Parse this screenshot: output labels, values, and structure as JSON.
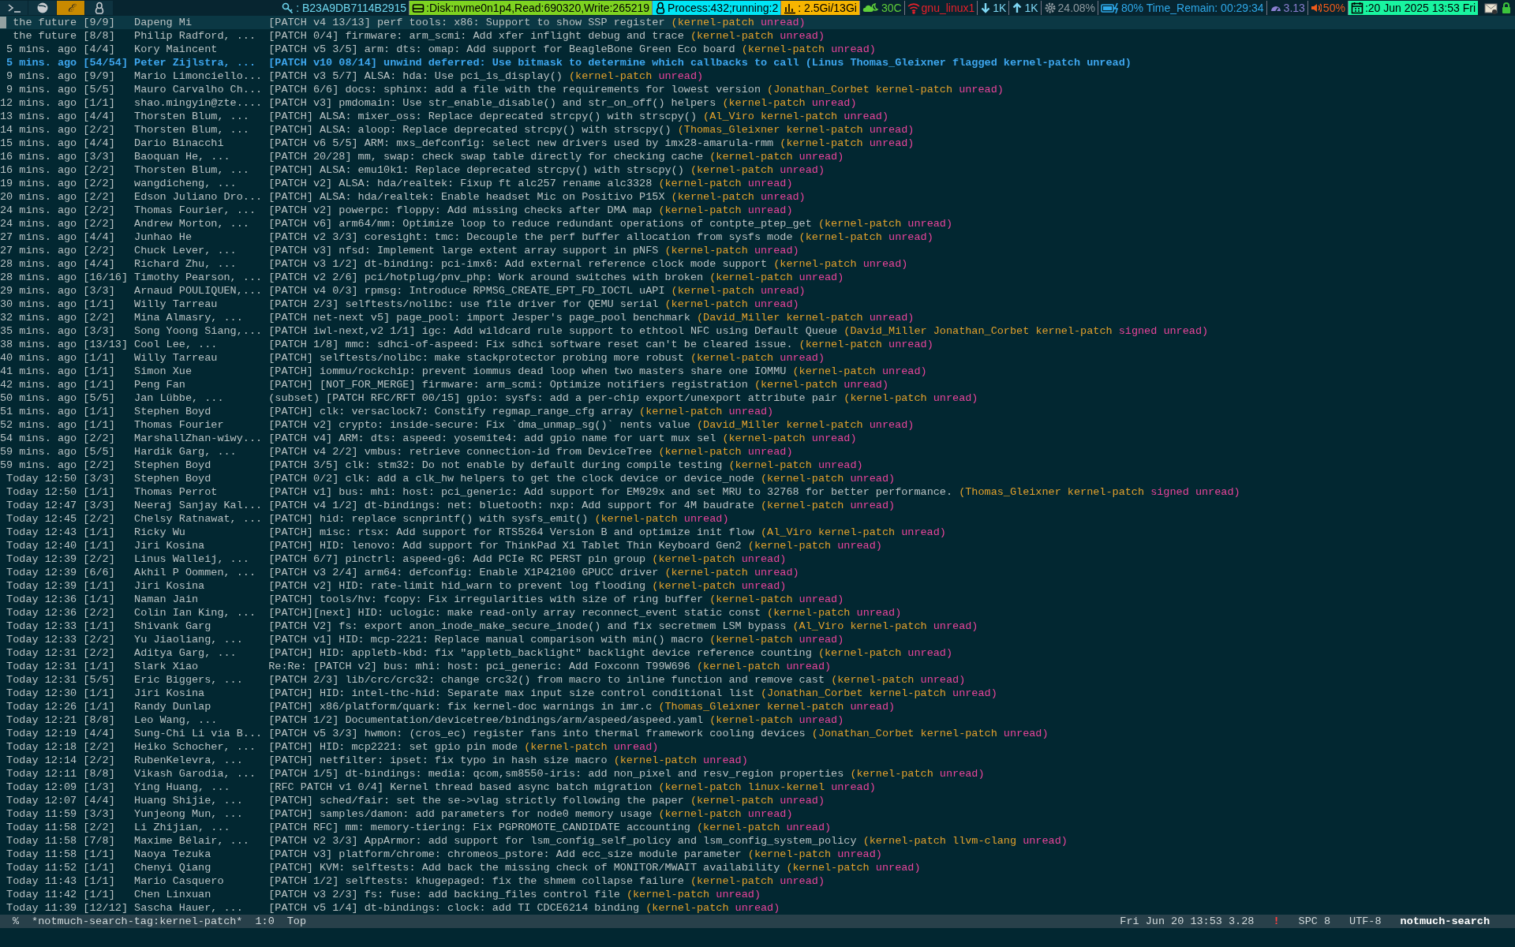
{
  "workspaces": [
    {
      "kind": "terminal",
      "selected": false
    },
    {
      "kind": "browser",
      "selected": false
    },
    {
      "kind": "text",
      "label": "ℰ",
      "selected": true
    },
    {
      "kind": "linux",
      "selected": false
    }
  ],
  "status_segments": [
    {
      "kind": "key",
      "text": ": B23A9DB7114B2915",
      "color": "#6fd8f0",
      "boxed": false
    },
    {
      "kind": "disk",
      "text": ":Disk:nvme0n1p4,Read:690320,Write:265219",
      "color": "#7ed321",
      "boxed": true
    },
    {
      "kind": "linux",
      "text": " Process:432;running:2",
      "color": "#00e5f5",
      "boxed": true
    },
    {
      "kind": "bars",
      "text": " : 2.5Gi/13Gi",
      "color": "#f7b500",
      "boxed": true
    },
    {
      "kind": "weather",
      "text": "30C",
      "color": "#5fcf3a",
      "boxed": false
    },
    {
      "kind": "wifi",
      "text": "gnu_linux1",
      "color": "#e8202a",
      "boxed": false
    },
    {
      "kind": "down",
      "text": "1K",
      "color": "#7fd8f5",
      "boxed": false
    },
    {
      "kind": "up",
      "text": "1K",
      "color": "#7fd8f5",
      "boxed": false
    },
    {
      "kind": "gear",
      "text": "24.08%",
      "color": "#8f9aa0",
      "boxed": false
    },
    {
      "kind": "battery",
      "text": "80% Time_Remain: 00:29:34",
      "color": "#2ea8e8",
      "boxed": false
    },
    {
      "kind": "gauge",
      "text": "3.13",
      "color": "#8a7fd0",
      "boxed": false
    },
    {
      "kind": "speaker",
      "text": "50%",
      "color": "#f05a1a",
      "boxed": false
    },
    {
      "kind": "calendar",
      "text": ":20 Jun 2025 13:53 Fri",
      "color": "#19f5a0",
      "boxed": true
    }
  ],
  "tray": [
    {
      "kind": "mail"
    },
    {
      "kind": "lock"
    }
  ],
  "rows": [
    {
      "date": "the future",
      "count": "[9/9]",
      "authors": "Dapeng Mi",
      "subject": "[PATCH v4 13/13] perf tools: x86: Support to show SSP register",
      "tags": [
        {
          "text": "(kernel-patch",
          "color": "#e2a12c"
        },
        {
          "text": "unread)",
          "color": "#e8449a"
        }
      ],
      "selected": true,
      "flagged": false
    },
    {
      "date": "the future",
      "count": "[8/8]",
      "authors": "Philip Radford, ...",
      "subject": "[PATCH 0/4] firmware: arm_scmi: Add xfer inflight debug and trace",
      "tags": [
        {
          "text": "(kernel-patch",
          "color": "#e2a12c"
        },
        {
          "text": "unread)",
          "color": "#e8449a"
        }
      ],
      "selected": false,
      "flagged": false
    },
    {
      "date": "5 mins. ago",
      "count": "[4/4]",
      "authors": "Kory Maincent",
      "subject": "[PATCH v5 3/5] arm: dts: omap: Add support for BeagleBone Green Eco board",
      "tags": [
        {
          "text": "(kernel-patch",
          "color": "#e2a12c"
        },
        {
          "text": "unread)",
          "color": "#e8449a"
        }
      ],
      "selected": false,
      "flagged": false
    },
    {
      "date": "5 mins. ago",
      "count": "[54/54]",
      "authors": "Peter Zijlstra, ...",
      "subject": "[PATCH v10 08/14] unwind deferred: Use bitmask to determine which callbacks to call",
      "tags": [
        {
          "text": "(Linus",
          "color": "#3ea6ee"
        },
        {
          "text": "Thomas_Gleixner",
          "color": "#3ea6ee"
        },
        {
          "text": "flagged",
          "color": "#3ea6ee"
        },
        {
          "text": "kernel-patch",
          "color": "#3ea6ee"
        },
        {
          "text": "unread)",
          "color": "#3ea6ee"
        }
      ],
      "selected": false,
      "flagged": true
    },
    {
      "date": "9 mins. ago",
      "count": "[9/9]",
      "authors": "Mario Limonciello...",
      "subject": "[PATCH v3 5/7] ALSA: hda: Use pci_is_display()",
      "tags": [
        {
          "text": "(kernel-patch",
          "color": "#e2a12c"
        },
        {
          "text": "unread)",
          "color": "#e8449a"
        }
      ],
      "selected": false,
      "flagged": false
    },
    {
      "date": "9 mins. ago",
      "count": "[5/5]",
      "authors": "Mauro Carvalho Ch...",
      "subject": "[PATCH 6/6] docs: sphinx: add a file with the requirements for lowest version",
      "tags": [
        {
          "text": "(Jonathan_Corbet",
          "color": "#e2a12c"
        },
        {
          "text": "kernel-patch",
          "color": "#e2a12c"
        },
        {
          "text": "unread)",
          "color": "#e8449a"
        }
      ],
      "selected": false,
      "flagged": false
    },
    {
      "date": "12 mins. ago",
      "count": "[1/1]",
      "authors": "shao.mingyin@zte....",
      "subject": "[PATCH v3] pmdomain: Use str_enable_disable() and str_on_off() helpers",
      "tags": [
        {
          "text": "(kernel-patch",
          "color": "#e2a12c"
        },
        {
          "text": "unread)",
          "color": "#e8449a"
        }
      ],
      "selected": false,
      "flagged": false
    },
    {
      "date": "13 mins. ago",
      "count": "[4/4]",
      "authors": "Thorsten Blum, ...",
      "subject": "[PATCH] ALSA: mixer_oss: Replace deprecated strcpy() with strscpy()",
      "tags": [
        {
          "text": "(Al_Viro",
          "color": "#e2a12c"
        },
        {
          "text": "kernel-patch",
          "color": "#e2a12c"
        },
        {
          "text": "unread)",
          "color": "#e8449a"
        }
      ],
      "selected": false,
      "flagged": false
    },
    {
      "date": "14 mins. ago",
      "count": "[2/2]",
      "authors": "Thorsten Blum, ...",
      "subject": "[PATCH] ALSA: aloop: Replace deprecated strcpy() with strscpy()",
      "tags": [
        {
          "text": "(Thomas_Gleixner",
          "color": "#e2a12c"
        },
        {
          "text": "kernel-patch",
          "color": "#e2a12c"
        },
        {
          "text": "unread)",
          "color": "#e8449a"
        }
      ],
      "selected": false,
      "flagged": false
    },
    {
      "date": "15 mins. ago",
      "count": "[4/4]",
      "authors": "Dario Binacchi",
      "subject": "[PATCH v6 5/5] ARM: mxs_defconfig: select new drivers used by imx28-amarula-rmm",
      "tags": [
        {
          "text": "(kernel-patch",
          "color": "#e2a12c"
        },
        {
          "text": "unread)",
          "color": "#e8449a"
        }
      ],
      "selected": false,
      "flagged": false
    },
    {
      "date": "16 mins. ago",
      "count": "[3/3]",
      "authors": "Baoquan He, ...",
      "subject": "[PATCH 20/28] mm, swap: check swap table directly for checking cache",
      "tags": [
        {
          "text": "(kernel-patch",
          "color": "#e2a12c"
        },
        {
          "text": "unread)",
          "color": "#e8449a"
        }
      ],
      "selected": false,
      "flagged": false
    },
    {
      "date": "16 mins. ago",
      "count": "[2/2]",
      "authors": "Thorsten Blum, ...",
      "subject": "[PATCH] ALSA: emu10k1: Replace deprecated strcpy() with strscpy()",
      "tags": [
        {
          "text": "(kernel-patch",
          "color": "#e2a12c"
        },
        {
          "text": "unread)",
          "color": "#e8449a"
        }
      ],
      "selected": false,
      "flagged": false
    },
    {
      "date": "19 mins. ago",
      "count": "[2/2]",
      "authors": "wangdicheng, ...",
      "subject": "[PATCH v2] ALSA: hda/realtek: Fixup ft alc257 rename alc3328",
      "tags": [
        {
          "text": "(kernel-patch",
          "color": "#e2a12c"
        },
        {
          "text": "unread)",
          "color": "#e8449a"
        }
      ],
      "selected": false,
      "flagged": false
    },
    {
      "date": "20 mins. ago",
      "count": "[2/2]",
      "authors": "Edson Juliano Dro...",
      "subject": "[PATCH] ALSA: hda/realtek: Enable headset Mic on Positivo P15X",
      "tags": [
        {
          "text": "(kernel-patch",
          "color": "#e2a12c"
        },
        {
          "text": "unread)",
          "color": "#e8449a"
        }
      ],
      "selected": false,
      "flagged": false
    },
    {
      "date": "24 mins. ago",
      "count": "[2/2]",
      "authors": "Thomas Fourier, ...",
      "subject": "[PATCH v2] powerpc: floppy: Add missing checks after DMA map",
      "tags": [
        {
          "text": "(kernel-patch",
          "color": "#e2a12c"
        },
        {
          "text": "unread)",
          "color": "#e8449a"
        }
      ],
      "selected": false,
      "flagged": false
    },
    {
      "date": "24 mins. ago",
      "count": "[2/2]",
      "authors": "Andrew Morton, ...",
      "subject": "[PATCH v6] arm64/mm: Optimize loop to reduce redundant operations of contpte_ptep_get",
      "tags": [
        {
          "text": "(kernel-patch",
          "color": "#e2a12c"
        },
        {
          "text": "unread)",
          "color": "#e8449a"
        }
      ],
      "selected": false,
      "flagged": false
    },
    {
      "date": "27 mins. ago",
      "count": "[4/4]",
      "authors": "Junhao He",
      "subject": "[PATCH v2 3/3] coresight: tmc: Decouple the perf buffer allocation from sysfs mode",
      "tags": [
        {
          "text": "(kernel-patch",
          "color": "#e2a12c"
        },
        {
          "text": "unread)",
          "color": "#e8449a"
        }
      ],
      "selected": false,
      "flagged": false
    },
    {
      "date": "27 mins. ago",
      "count": "[2/2]",
      "authors": "Chuck Lever, ...",
      "subject": "[PATCH v3] nfsd: Implement large extent array support in pNFS",
      "tags": [
        {
          "text": "(kernel-patch",
          "color": "#e2a12c"
        },
        {
          "text": "unread)",
          "color": "#e8449a"
        }
      ],
      "selected": false,
      "flagged": false
    },
    {
      "date": "28 mins. ago",
      "count": "[4/4]",
      "authors": "Richard Zhu, ...",
      "subject": "[PATCH v3 1/2] dt-binding: pci-imx6: Add external reference clock mode support",
      "tags": [
        {
          "text": "(kernel-patch",
          "color": "#e2a12c"
        },
        {
          "text": "unread)",
          "color": "#e8449a"
        }
      ],
      "selected": false,
      "flagged": false
    },
    {
      "date": "28 mins. ago",
      "count": "[16/16]",
      "authors": "Timothy Pearson, ...",
      "subject": "[PATCH v2 2/6] pci/hotplug/pnv_php: Work around switches with broken",
      "tags": [
        {
          "text": "(kernel-patch",
          "color": "#e2a12c"
        },
        {
          "text": "unread)",
          "color": "#e8449a"
        }
      ],
      "selected": false,
      "flagged": false
    },
    {
      "date": "29 mins. ago",
      "count": "[3/3]",
      "authors": "Arnaud POULIQUEN,...",
      "subject": "[PATCH v4 0/3] rpmsg: Introduce RPMSG_CREATE_EPT_FD_IOCTL uAPI",
      "tags": [
        {
          "text": "(kernel-patch",
          "color": "#e2a12c"
        },
        {
          "text": "unread)",
          "color": "#e8449a"
        }
      ],
      "selected": false,
      "flagged": false
    },
    {
      "date": "30 mins. ago",
      "count": "[1/1]",
      "authors": "Willy Tarreau",
      "subject": "[PATCH 2/3] selftests/nolibc: use file driver for QEMU serial",
      "tags": [
        {
          "text": "(kernel-patch",
          "color": "#e2a12c"
        },
        {
          "text": "unread)",
          "color": "#e8449a"
        }
      ],
      "selected": false,
      "flagged": false
    },
    {
      "date": "32 mins. ago",
      "count": "[2/2]",
      "authors": "Mina Almasry, ...",
      "subject": "[PATCH net-next v5] page_pool: import Jesper's page_pool benchmark",
      "tags": [
        {
          "text": "(David_Miller",
          "color": "#e2a12c"
        },
        {
          "text": "kernel-patch",
          "color": "#e2a12c"
        },
        {
          "text": "unread)",
          "color": "#e8449a"
        }
      ],
      "selected": false,
      "flagged": false
    },
    {
      "date": "35 mins. ago",
      "count": "[3/3]",
      "authors": "Song Yoong Siang,...",
      "subject": "[PATCH iwl-next,v2 1/1] igc: Add wildcard rule support to ethtool NFC using Default Queue",
      "tags": [
        {
          "text": "(David_Miller",
          "color": "#e2a12c"
        },
        {
          "text": "Jonathan_Corbet",
          "color": "#e2a12c"
        },
        {
          "text": "kernel-patch",
          "color": "#e2a12c"
        },
        {
          "text": "signed",
          "color": "#e8449a"
        },
        {
          "text": "unread)",
          "color": "#e8449a"
        }
      ],
      "selected": false,
      "flagged": false
    },
    {
      "date": "38 mins. ago",
      "count": "[13/13]",
      "authors": "Cool Lee, ...",
      "subject": "[PATCH 1/8] mmc: sdhci-of-aspeed: Fix sdhci software reset can't be cleared issue.",
      "tags": [
        {
          "text": "(kernel-patch",
          "color": "#e2a12c"
        },
        {
          "text": "unread)",
          "color": "#e8449a"
        }
      ],
      "selected": false,
      "flagged": false
    },
    {
      "date": "40 mins. ago",
      "count": "[1/1]",
      "authors": "Willy Tarreau",
      "subject": "[PATCH] selftests/nolibc: make stackprotector probing more robust",
      "tags": [
        {
          "text": "(kernel-patch",
          "color": "#e2a12c"
        },
        {
          "text": "unread)",
          "color": "#e8449a"
        }
      ],
      "selected": false,
      "flagged": false
    },
    {
      "date": "41 mins. ago",
      "count": "[1/1]",
      "authors": "Simon Xue",
      "subject": "[PATCH] iommu/rockchip: prevent iommus dead loop when two masters share one IOMMU",
      "tags": [
        {
          "text": "(kernel-patch",
          "color": "#e2a12c"
        },
        {
          "text": "unread)",
          "color": "#e8449a"
        }
      ],
      "selected": false,
      "flagged": false
    },
    {
      "date": "42 mins. ago",
      "count": "[1/1]",
      "authors": "Peng Fan",
      "subject": "[PATCH] [NOT_FOR_MERGE] firmware: arm_scmi: Optimize notifiers registration",
      "tags": [
        {
          "text": "(kernel-patch",
          "color": "#e2a12c"
        },
        {
          "text": "unread)",
          "color": "#e8449a"
        }
      ],
      "selected": false,
      "flagged": false
    },
    {
      "date": "50 mins. ago",
      "count": "[5/5]",
      "authors": "Jan Lübbe, ...",
      "subject": "(subset) [PATCH RFC/RFT 00/15] gpio: sysfs: add a per-chip export/unexport attribute pair",
      "tags": [
        {
          "text": "(kernel-patch",
          "color": "#e2a12c"
        },
        {
          "text": "unread)",
          "color": "#e8449a"
        }
      ],
      "selected": false,
      "flagged": false
    },
    {
      "date": "51 mins. ago",
      "count": "[1/1]",
      "authors": "Stephen Boyd",
      "subject": "[PATCH] clk: versaclock7: Constify regmap_range_cfg array",
      "tags": [
        {
          "text": "(kernel-patch",
          "color": "#e2a12c"
        },
        {
          "text": "unread)",
          "color": "#e8449a"
        }
      ],
      "selected": false,
      "flagged": false
    },
    {
      "date": "52 mins. ago",
      "count": "[1/1]",
      "authors": "Thomas Fourier",
      "subject": "[PATCH v2] crypto: inside-secure: Fix `dma_unmap_sg()` nents value",
      "tags": [
        {
          "text": "(David_Miller",
          "color": "#e2a12c"
        },
        {
          "text": "kernel-patch",
          "color": "#e2a12c"
        },
        {
          "text": "unread)",
          "color": "#e8449a"
        }
      ],
      "selected": false,
      "flagged": false
    },
    {
      "date": "54 mins. ago",
      "count": "[2/2]",
      "authors": "MarshallZhan-wiwy...",
      "subject": "[PATCH v4] ARM: dts: aspeed: yosemite4: add gpio name for uart mux sel",
      "tags": [
        {
          "text": "(kernel-patch",
          "color": "#e2a12c"
        },
        {
          "text": "unread)",
          "color": "#e8449a"
        }
      ],
      "selected": false,
      "flagged": false
    },
    {
      "date": "59 mins. ago",
      "count": "[5/5]",
      "authors": "Hardik Garg, ...",
      "subject": "[PATCH v4 2/2] vmbus: retrieve connection-id from DeviceTree",
      "tags": [
        {
          "text": "(kernel-patch",
          "color": "#e2a12c"
        },
        {
          "text": "unread)",
          "color": "#e8449a"
        }
      ],
      "selected": false,
      "flagged": false
    },
    {
      "date": "59 mins. ago",
      "count": "[2/2]",
      "authors": "Stephen Boyd",
      "subject": "[PATCH 3/5] clk: stm32: Do not enable by default during compile testing",
      "tags": [
        {
          "text": "(kernel-patch",
          "color": "#e2a12c"
        },
        {
          "text": "unread)",
          "color": "#e8449a"
        }
      ],
      "selected": false,
      "flagged": false
    },
    {
      "date": "Today 12:50",
      "count": "[3/3]",
      "authors": "Stephen Boyd",
      "subject": "[PATCH 0/2] clk: add a clk_hw helpers to get the clock device or device_node",
      "tags": [
        {
          "text": "(kernel-patch",
          "color": "#e2a12c"
        },
        {
          "text": "unread)",
          "color": "#e8449a"
        }
      ],
      "selected": false,
      "flagged": false
    },
    {
      "date": "Today 12:50",
      "count": "[1/1]",
      "authors": "Thomas Perrot",
      "subject": "[PATCH v1] bus: mhi: host: pci_generic: Add support for EM929x and set MRU to 32768 for better performance.",
      "tags": [
        {
          "text": "(Thomas_Gleixner",
          "color": "#e2a12c"
        },
        {
          "text": "kernel-patch",
          "color": "#e2a12c"
        },
        {
          "text": "signed",
          "color": "#e8449a"
        },
        {
          "text": "unread)",
          "color": "#e8449a"
        }
      ],
      "selected": false,
      "flagged": false
    },
    {
      "date": "Today 12:47",
      "count": "[3/3]",
      "authors": "Neeraj Sanjay Kal...",
      "subject": "[PATCH v4 1/2] dt-bindings: net: bluetooth: nxp: Add support for 4M baudrate",
      "tags": [
        {
          "text": "(kernel-patch",
          "color": "#e2a12c"
        },
        {
          "text": "unread)",
          "color": "#e8449a"
        }
      ],
      "selected": false,
      "flagged": false
    },
    {
      "date": "Today 12:45",
      "count": "[2/2]",
      "authors": "Chelsy Ratnawat, ...",
      "subject": "[PATCH] hid: replace scnprintf() with sysfs_emit()",
      "tags": [
        {
          "text": "(kernel-patch",
          "color": "#e2a12c"
        },
        {
          "text": "unread)",
          "color": "#e8449a"
        }
      ],
      "selected": false,
      "flagged": false
    },
    {
      "date": "Today 12:43",
      "count": "[1/1]",
      "authors": "Ricky Wu",
      "subject": "[PATCH] misc: rtsx: Add support for RTS5264 Version B and optimize init flow",
      "tags": [
        {
          "text": "(Al_Viro",
          "color": "#e2a12c"
        },
        {
          "text": "kernel-patch",
          "color": "#e2a12c"
        },
        {
          "text": "unread)",
          "color": "#e8449a"
        }
      ],
      "selected": false,
      "flagged": false
    },
    {
      "date": "Today 12:40",
      "count": "[1/1]",
      "authors": "Jiri Kosina",
      "subject": "[PATCH] HID: lenovo: Add support for ThinkPad X1 Tablet Thin Keyboard Gen2",
      "tags": [
        {
          "text": "(kernel-patch",
          "color": "#e2a12c"
        },
        {
          "text": "unread)",
          "color": "#e8449a"
        }
      ],
      "selected": false,
      "flagged": false
    },
    {
      "date": "Today 12:39",
      "count": "[2/2]",
      "authors": "Linus Walleij, ...",
      "subject": "[PATCH 6/7] pinctrl: aspeed-g6: Add PCIe RC PERST pin group",
      "tags": [
        {
          "text": "(kernel-patch",
          "color": "#e2a12c"
        },
        {
          "text": "unread)",
          "color": "#e8449a"
        }
      ],
      "selected": false,
      "flagged": false
    },
    {
      "date": "Today 12:39",
      "count": "[6/6]",
      "authors": "Akhil P Oommen, ...",
      "subject": "[PATCH v3 2/4] arm64: defconfig: Enable X1P42100 GPUCC driver",
      "tags": [
        {
          "text": "(kernel-patch",
          "color": "#e2a12c"
        },
        {
          "text": "unread)",
          "color": "#e8449a"
        }
      ],
      "selected": false,
      "flagged": false
    },
    {
      "date": "Today 12:39",
      "count": "[1/1]",
      "authors": "Jiri Kosina",
      "subject": "[PATCH v2] HID: rate-limit hid_warn to prevent log flooding",
      "tags": [
        {
          "text": "(kernel-patch",
          "color": "#e2a12c"
        },
        {
          "text": "unread)",
          "color": "#e8449a"
        }
      ],
      "selected": false,
      "flagged": false
    },
    {
      "date": "Today 12:36",
      "count": "[1/1]",
      "authors": "Naman Jain",
      "subject": "[PATCH] tools/hv: fcopy: Fix irregularities with size of ring buffer",
      "tags": [
        {
          "text": "(kernel-patch",
          "color": "#e2a12c"
        },
        {
          "text": "unread)",
          "color": "#e8449a"
        }
      ],
      "selected": false,
      "flagged": false
    },
    {
      "date": "Today 12:36",
      "count": "[2/2]",
      "authors": "Colin Ian King, ...",
      "subject": "[PATCH][next] HID: uclogic: make read-only array reconnect_event static const",
      "tags": [
        {
          "text": "(kernel-patch",
          "color": "#e2a12c"
        },
        {
          "text": "unread)",
          "color": "#e8449a"
        }
      ],
      "selected": false,
      "flagged": false
    },
    {
      "date": "Today 12:33",
      "count": "[1/1]",
      "authors": "Shivank Garg",
      "subject": "[PATCH V2] fs: export anon_inode_make_secure_inode() and fix secretmem LSM bypass",
      "tags": [
        {
          "text": "(Al_Viro",
          "color": "#e2a12c"
        },
        {
          "text": "kernel-patch",
          "color": "#e2a12c"
        },
        {
          "text": "unread)",
          "color": "#e8449a"
        }
      ],
      "selected": false,
      "flagged": false
    },
    {
      "date": "Today 12:33",
      "count": "[2/2]",
      "authors": "Yu Jiaoliang, ...",
      "subject": "[PATCH v1] HID: mcp-2221: Replace manual comparison with min() macro",
      "tags": [
        {
          "text": "(kernel-patch",
          "color": "#e2a12c"
        },
        {
          "text": "unread)",
          "color": "#e8449a"
        }
      ],
      "selected": false,
      "flagged": false
    },
    {
      "date": "Today 12:31",
      "count": "[2/2]",
      "authors": "Aditya Garg, ...",
      "subject": "[PATCH] HID: appletb-kbd: fix \"appletb_backlight\" backlight device reference counting",
      "tags": [
        {
          "text": "(kernel-patch",
          "color": "#e2a12c"
        },
        {
          "text": "unread)",
          "color": "#e8449a"
        }
      ],
      "selected": false,
      "flagged": false
    },
    {
      "date": "Today 12:31",
      "count": "[1/1]",
      "authors": "Slark Xiao",
      "subject": "Re:Re: [PATCH v2] bus: mhi: host: pci_generic: Add Foxconn T99W696",
      "tags": [
        {
          "text": "(kernel-patch",
          "color": "#e2a12c"
        },
        {
          "text": "unread)",
          "color": "#e8449a"
        }
      ],
      "selected": false,
      "flagged": false
    },
    {
      "date": "Today 12:31",
      "count": "[5/5]",
      "authors": "Eric Biggers, ...",
      "subject": "[PATCH 2/3] lib/crc/crc32: change crc32() from macro to inline function and remove cast",
      "tags": [
        {
          "text": "(kernel-patch",
          "color": "#e2a12c"
        },
        {
          "text": "unread)",
          "color": "#e8449a"
        }
      ],
      "selected": false,
      "flagged": false
    },
    {
      "date": "Today 12:30",
      "count": "[1/1]",
      "authors": "Jiri Kosina",
      "subject": "[PATCH] HID: intel-thc-hid: Separate max input size control conditional list",
      "tags": [
        {
          "text": "(Jonathan_Corbet",
          "color": "#e2a12c"
        },
        {
          "text": "kernel-patch",
          "color": "#e2a12c"
        },
        {
          "text": "unread)",
          "color": "#e8449a"
        }
      ],
      "selected": false,
      "flagged": false
    },
    {
      "date": "Today 12:26",
      "count": "[1/1]",
      "authors": "Randy Dunlap",
      "subject": "[PATCH] x86/platform/quark: fix kernel-doc warnings in imr.c",
      "tags": [
        {
          "text": "(Thomas_Gleixner",
          "color": "#e2a12c"
        },
        {
          "text": "kernel-patch",
          "color": "#e2a12c"
        },
        {
          "text": "unread)",
          "color": "#e8449a"
        }
      ],
      "selected": false,
      "flagged": false
    },
    {
      "date": "Today 12:21",
      "count": "[8/8]",
      "authors": "Leo Wang, ...",
      "subject": "[PATCH 1/2] Documentation/devicetree/bindings/arm/aspeed/aspeed.yaml",
      "tags": [
        {
          "text": "(kernel-patch",
          "color": "#e2a12c"
        },
        {
          "text": "unread)",
          "color": "#e8449a"
        }
      ],
      "selected": false,
      "flagged": false
    },
    {
      "date": "Today 12:19",
      "count": "[4/4]",
      "authors": "Sung-Chi Li via B...",
      "subject": "[PATCH v5 3/3] hwmon: (cros_ec) register fans into thermal framework cooling devices",
      "tags": [
        {
          "text": "(Jonathan_Corbet",
          "color": "#e2a12c"
        },
        {
          "text": "kernel-patch",
          "color": "#e2a12c"
        },
        {
          "text": "unread)",
          "color": "#e8449a"
        }
      ],
      "selected": false,
      "flagged": false
    },
    {
      "date": "Today 12:18",
      "count": "[2/2]",
      "authors": "Heiko Schocher, ...",
      "subject": "[PATCH] HID: mcp2221: set gpio pin mode",
      "tags": [
        {
          "text": "(kernel-patch",
          "color": "#e2a12c"
        },
        {
          "text": "unread)",
          "color": "#e8449a"
        }
      ],
      "selected": false,
      "flagged": false
    },
    {
      "date": "Today 12:14",
      "count": "[2/2]",
      "authors": "RubenKelevra, ...",
      "subject": "[PATCH] netfilter: ipset: fix typo in hash size macro",
      "tags": [
        {
          "text": "(kernel-patch",
          "color": "#e2a12c"
        },
        {
          "text": "unread)",
          "color": "#e8449a"
        }
      ],
      "selected": false,
      "flagged": false
    },
    {
      "date": "Today 12:11",
      "count": "[8/8]",
      "authors": "Vikash Garodia, ...",
      "subject": "[PATCH 1/5] dt-bindings: media: qcom,sm8550-iris: add non_pixel and resv_region properties",
      "tags": [
        {
          "text": "(kernel-patch",
          "color": "#e2a12c"
        },
        {
          "text": "unread)",
          "color": "#e8449a"
        }
      ],
      "selected": false,
      "flagged": false
    },
    {
      "date": "Today 12:09",
      "count": "[1/3]",
      "authors": "Ying Huang, ...",
      "subject": "[RFC PATCH v1 0/4] Kernel thread based async batch migration",
      "tags": [
        {
          "text": "(kernel-patch",
          "color": "#e2a12c"
        },
        {
          "text": "linux-kernel",
          "color": "#e2a12c"
        },
        {
          "text": "unread)",
          "color": "#e8449a"
        }
      ],
      "selected": false,
      "flagged": false
    },
    {
      "date": "Today 12:07",
      "count": "[4/4]",
      "authors": "Huang Shijie, ...",
      "subject": "[PATCH] sched/fair: set the se->vlag strictly following the paper",
      "tags": [
        {
          "text": "(kernel-patch",
          "color": "#e2a12c"
        },
        {
          "text": "unread)",
          "color": "#e8449a"
        }
      ],
      "selected": false,
      "flagged": false
    },
    {
      "date": "Today 11:59",
      "count": "[3/3]",
      "authors": "Yunjeong Mun, ...",
      "subject": "[PATCH] samples/damon: add parameters for node0 memory usage",
      "tags": [
        {
          "text": "(kernel-patch",
          "color": "#e2a12c"
        },
        {
          "text": "unread)",
          "color": "#e8449a"
        }
      ],
      "selected": false,
      "flagged": false
    },
    {
      "date": "Today 11:58",
      "count": "[2/2]",
      "authors": "Li Zhijian, ...",
      "subject": "[PATCH RFC] mm: memory-tiering: Fix PGPROMOTE_CANDIDATE accounting",
      "tags": [
        {
          "text": "(kernel-patch",
          "color": "#e2a12c"
        },
        {
          "text": "unread)",
          "color": "#e8449a"
        }
      ],
      "selected": false,
      "flagged": false
    },
    {
      "date": "Today 11:58",
      "count": "[7/8]",
      "authors": "Maxime Bélair, ...",
      "subject": "[PATCH v2 3/3] AppArmor: add support for lsm_config_self_policy and lsm_config_system_policy",
      "tags": [
        {
          "text": "(kernel-patch",
          "color": "#e2a12c"
        },
        {
          "text": "llvm-clang",
          "color": "#e2a12c"
        },
        {
          "text": "unread)",
          "color": "#e8449a"
        }
      ],
      "selected": false,
      "flagged": false
    },
    {
      "date": "Today 11:58",
      "count": "[1/1]",
      "authors": "Naoya Tezuka",
      "subject": "[PATCH v3] platform/chrome: chromeos_pstore: Add ecc_size module parameter",
      "tags": [
        {
          "text": "(kernel-patch",
          "color": "#e2a12c"
        },
        {
          "text": "unread)",
          "color": "#e8449a"
        }
      ],
      "selected": false,
      "flagged": false
    },
    {
      "date": "Today 11:52",
      "count": "[1/1]",
      "authors": "Chenyi Qiang",
      "subject": "[PATCH] KVM: selftests: Add back the missing check of MONITOR/MWAIT availability",
      "tags": [
        {
          "text": "(kernel-patch",
          "color": "#e2a12c"
        },
        {
          "text": "unread)",
          "color": "#e8449a"
        }
      ],
      "selected": false,
      "flagged": false
    },
    {
      "date": "Today 11:43",
      "count": "[1/1]",
      "authors": "Mario Casquero",
      "subject": "[PATCH 1/2] selftests: khugepaged: fix the shmem collapse failure",
      "tags": [
        {
          "text": "(kernel-patch",
          "color": "#e2a12c"
        },
        {
          "text": "unread)",
          "color": "#e8449a"
        }
      ],
      "selected": false,
      "flagged": false
    },
    {
      "date": "Today 11:42",
      "count": "[1/1]",
      "authors": "Chen Linxuan",
      "subject": "[PATCH v3 2/3] fs: fuse: add backing_files control file",
      "tags": [
        {
          "text": "(kernel-patch",
          "color": "#e2a12c"
        },
        {
          "text": "unread)",
          "color": "#e8449a"
        }
      ],
      "selected": false,
      "flagged": false
    },
    {
      "date": "Today 11:39",
      "count": "[12/12]",
      "authors": "Sascha Hauer, ...",
      "subject": "[PATCH v5 1/4] dt-bindings: clock: add TI CDCE6214 binding",
      "tags": [
        {
          "text": "(kernel-patch",
          "color": "#e2a12c"
        },
        {
          "text": "unread)",
          "color": "#e8449a"
        }
      ],
      "selected": false,
      "flagged": false
    }
  ],
  "mode_line": {
    "left": [
      {
        "kind": "plain",
        "text": "%"
      },
      {
        "kind": "plain",
        "text": "*notmuch-search-tag:kernel-patch*"
      },
      {
        "kind": "plain",
        "text": "1:0"
      },
      {
        "kind": "plain",
        "text": "Top"
      }
    ],
    "right": [
      {
        "kind": "plain",
        "text": "Fri Jun 20 13:53 3.28"
      },
      {
        "kind": "warning",
        "text": "!"
      },
      {
        "kind": "plain",
        "text": "SPC 8"
      },
      {
        "kind": "plain",
        "text": "UTF-8"
      },
      {
        "kind": "mode",
        "text": "notmuch-search"
      }
    ]
  }
}
